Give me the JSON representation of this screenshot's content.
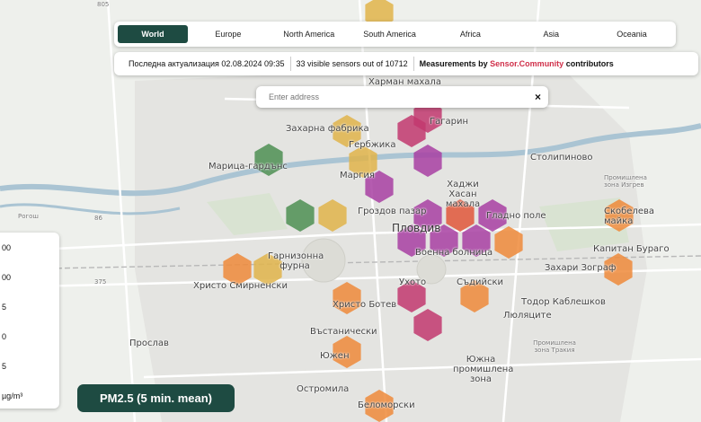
{
  "regions": [
    "World",
    "Europe",
    "North America",
    "South America",
    "Africa",
    "Asia",
    "Oceania"
  ],
  "active_region": "World",
  "info": {
    "last_update_label": "Последна актуализация",
    "last_update_value": "02.08.2024 09:35",
    "visible_count": "33",
    "visible_text": "visible sensors out of",
    "total_count": "10712",
    "measurements_prefix": "Measurements by",
    "source_name": "Sensor.Community",
    "measurements_suffix": "contributors"
  },
  "search": {
    "placeholder": "Enter address",
    "clear_glyph": "×"
  },
  "legend": {
    "ticks": [
      "00",
      "00",
      "5",
      "0",
      "5",
      "µg/m³"
    ]
  },
  "pm_badge": "PM2.5 (5 min. mean)",
  "colors": {
    "green": "#4e8f52",
    "yellow": "#e0b44a",
    "orange": "#ef8a3a",
    "red": "#e0573a",
    "purple": "#a83fa2",
    "magenta": "#c2386e",
    "brand": "#1e4b42"
  },
  "map_labels": [
    "Харман махала",
    "Гагарин",
    "Захарна фабрика",
    "Гербжика",
    "Марица-гардънс",
    "Маргия",
    "Хаджи Хасан махала",
    "Столипиново",
    "Гроздов пазар",
    "Гладно поле",
    "Пловдив",
    "Скобелева майка",
    "Гарнизонна фурна",
    "Военна болница",
    "Капитан Бураго",
    "Христо Смирненски",
    "Захари Зограф",
    "Ухото",
    "Съдийски",
    "Христо Ботев",
    "Тодор Каблешков",
    "Люляците",
    "Въстанически",
    "Прослав",
    "Южен",
    "Южна промишлена зона",
    "Промишлена зона Тракия",
    "Остромила",
    "Беломорски",
    "Промишлена зона Изгрев",
    "Рогош"
  ],
  "road_labels": [
    "86",
    "375",
    "805"
  ]
}
